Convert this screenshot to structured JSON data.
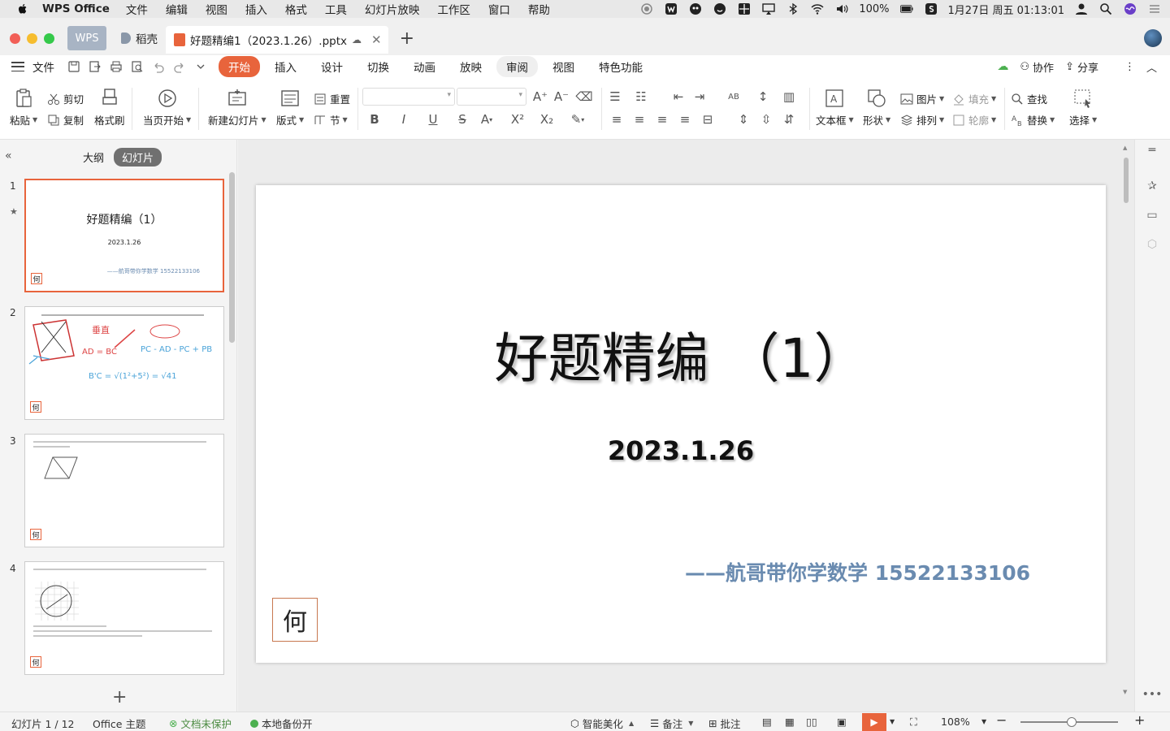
{
  "menubar": {
    "app_name": "WPS Office",
    "items": [
      "文件",
      "编辑",
      "视图",
      "插入",
      "格式",
      "工具",
      "幻灯片放映",
      "工作区",
      "窗口",
      "帮助"
    ],
    "battery": "100%",
    "datetime": "1月27日 周五 01:13:01"
  },
  "tabs": {
    "wps": "WPS",
    "daoke": "稻壳",
    "doc": "好题精编1（2023.1.26）.pptx"
  },
  "ribbon": {
    "file": "文件",
    "tabs": [
      "开始",
      "插入",
      "设计",
      "切换",
      "动画",
      "放映",
      "审阅",
      "视图",
      "特色功能"
    ],
    "collab": "协作",
    "share": "分享"
  },
  "toolbar": {
    "paste": "粘贴",
    "cut": "剪切",
    "copy": "复制",
    "format_painter": "格式刷",
    "from_current": "当页开始",
    "new_slide": "新建幻灯片",
    "layout": "版式",
    "reset": "重置",
    "section": "节",
    "textbox": "文本框",
    "shape": "形状",
    "picture": "图片",
    "fill": "填充",
    "arrange": "排列",
    "outline": "轮廓",
    "find": "查找",
    "replace": "替换",
    "select": "选择"
  },
  "panel": {
    "outline_tab": "大纲",
    "slides_tab": "幻灯片",
    "thumbs": [
      {
        "num": "1",
        "title": "好题精编（1）",
        "date": "2023.1.26",
        "author": "——航哥带你学数学 15522133106"
      },
      {
        "num": "2"
      },
      {
        "num": "3"
      },
      {
        "num": "4"
      }
    ],
    "badge": "何"
  },
  "slide": {
    "title": "好题精编 （1）",
    "date": "2023.1.26",
    "author": "——航哥带你学数学 15522133106",
    "stamp": "何"
  },
  "status": {
    "slide_count": "幻灯片 1 / 12",
    "theme": "Office 主题",
    "unprotected": "文档未保护",
    "backup": "本地备份开",
    "beautify": "智能美化",
    "notes": "备注",
    "comment": "批注",
    "zoom": "108%"
  },
  "colors": {
    "accent": "#e8643c",
    "author_text": "#6a8bb0"
  }
}
